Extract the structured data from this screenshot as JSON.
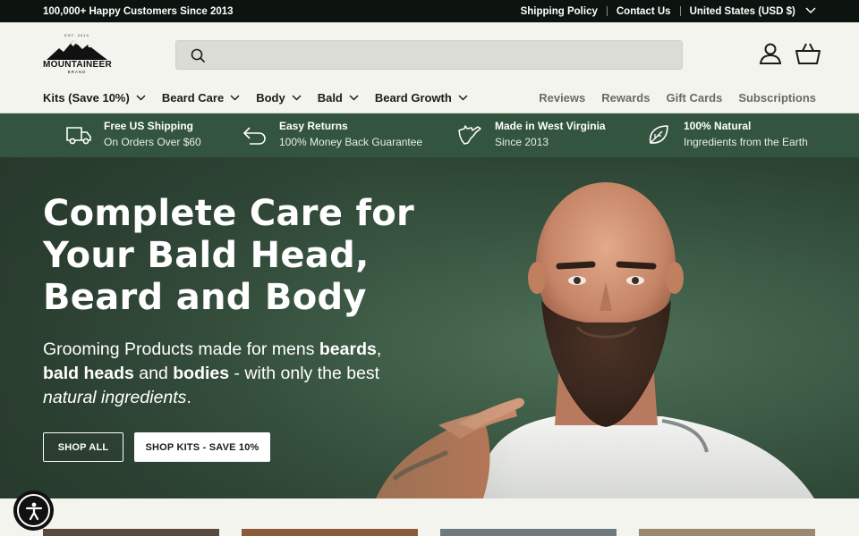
{
  "announcement": {
    "left_text": "100,000+ Happy Customers Since 2013",
    "links": [
      "Shipping Policy",
      "Contact Us"
    ],
    "currency": "United States (USD $)"
  },
  "header": {
    "logo": {
      "est": "EST. 2013",
      "name": "MOUNTAINEER",
      "sub": "BRAND"
    },
    "search_placeholder": "",
    "nav_left": [
      "Kits (Save 10%)",
      "Beard Care",
      "Body",
      "Bald",
      "Beard Growth"
    ],
    "nav_right": [
      "Reviews",
      "Rewards",
      "Gift Cards",
      "Subscriptions"
    ]
  },
  "features": [
    {
      "icon": "truck-icon",
      "title": "Free US Shipping",
      "subtitle": "On Orders Over $60"
    },
    {
      "icon": "return-arrow-icon",
      "title": "Easy Returns",
      "subtitle": "100% Money Back Guarantee"
    },
    {
      "icon": "west-virginia-icon",
      "title": "Made in West Virginia",
      "subtitle": "Since 2013"
    },
    {
      "icon": "leaf-icon",
      "title": "100% Natural",
      "subtitle": "Ingredients from the Earth"
    }
  ],
  "hero": {
    "title": "Complete Care for Your Bald Head, Beard and Body",
    "sub_parts": {
      "a": "Grooming Products made for mens ",
      "b": "beards",
      "c": ", ",
      "d": "bald heads",
      "e": " and ",
      "f": "bodies",
      "g": " - with only the best ",
      "h": "natural ingredients",
      "i": "."
    },
    "btn_shop_all": "SHOP ALL",
    "btn_shop_kits": "SHOP KITS - SAVE 10%"
  },
  "colors": {
    "topbar": "#0d1410",
    "feature_bar": "#33553f",
    "hero_bg": "#3c5a45",
    "page_bg": "#f4f4ef"
  }
}
